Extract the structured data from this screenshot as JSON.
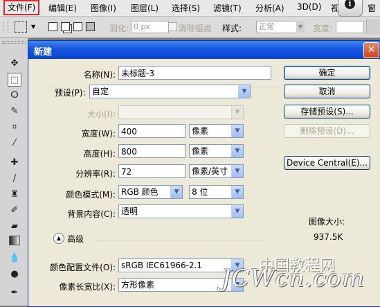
{
  "menubar": {
    "items": [
      "文件(F)",
      "编辑(E)",
      "图像(I)",
      "图层(L)",
      "选择(S)",
      "滤镜(T)",
      "分析(A)",
      "3D(D)",
      "视",
      "窗"
    ]
  },
  "optionsbar": {
    "feather_label": "羽化:",
    "feather_value": "0 px",
    "antialias_label": "消除锯齿",
    "style_label": "样式:",
    "style_value": "正常",
    "width_label": "宽度:"
  },
  "dialog": {
    "title": "新建",
    "name_label": "名称(N):",
    "name_value": "未标题-3",
    "preset_label": "预设(P):",
    "preset_value": "自定",
    "size_label": "大小(I):",
    "width_label": "宽度(W):",
    "width_value": "400",
    "width_unit": "像素",
    "height_label": "高度(H):",
    "height_value": "800",
    "height_unit": "像素",
    "resolution_label": "分辨率(R):",
    "resolution_value": "72",
    "resolution_unit": "像素/英寸",
    "color_mode_label": "颜色模式(M):",
    "color_mode_value": "RGB 颜色",
    "bit_depth_value": "8 位",
    "background_label": "背景内容(C):",
    "background_value": "透明",
    "advanced_label": "高级",
    "color_profile_label": "颜色配置文件(O):",
    "color_profile_value": "sRGB IEC61966-2.1",
    "pixel_aspect_label": "像素长宽比(X):",
    "pixel_aspect_value": "方形像素",
    "ok_button": "确定",
    "cancel_button": "取消",
    "save_preset_button": "存储预设(S)...",
    "delete_preset_button": "删除预设(D)...",
    "device_central_button": "Device Central(E)...",
    "image_size_label": "图像大小:",
    "image_size_value": "937.5K"
  },
  "watermark": {
    "cn": "中国教程网",
    "en": "JCWcn.com"
  },
  "colors": {
    "titlebar": "#0a47d6",
    "dialog_bg": "#ece9d8",
    "highlight": "#e8262a"
  }
}
